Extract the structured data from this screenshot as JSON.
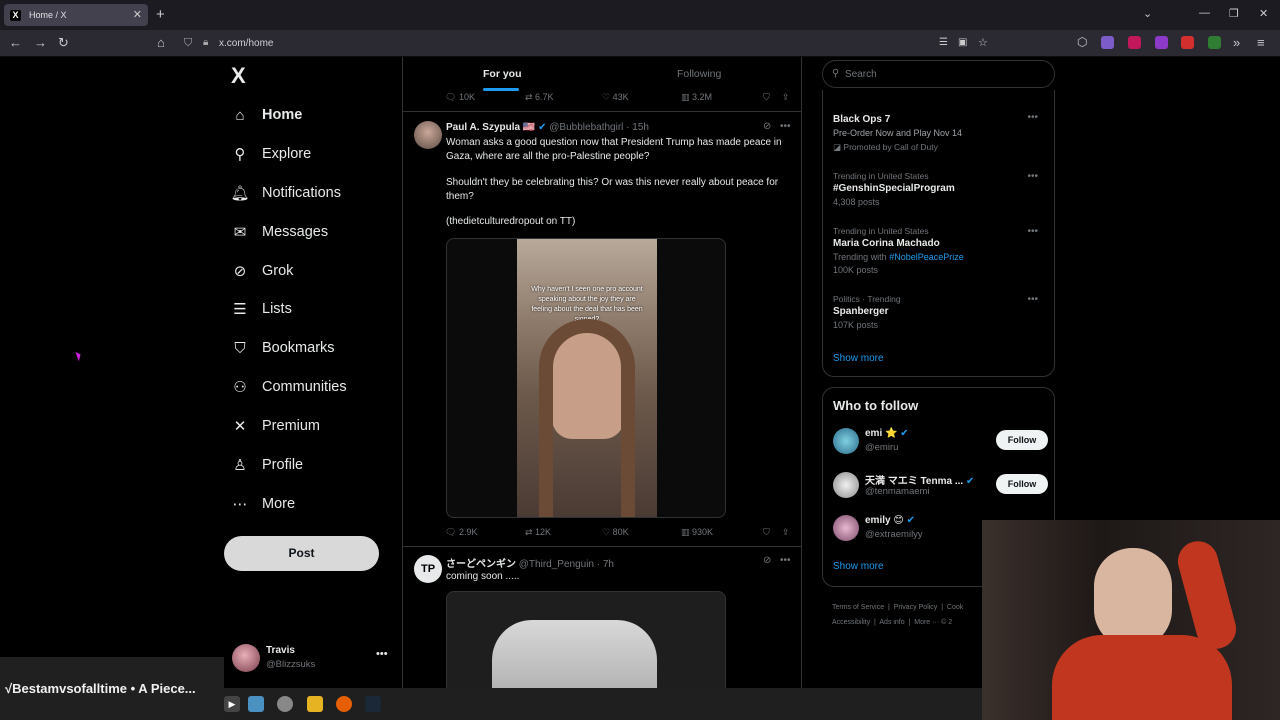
{
  "browser": {
    "tab_title": "Home / X",
    "url": "x.com/home"
  },
  "nav": {
    "logo": "X",
    "items": [
      {
        "label": "Home",
        "icon": "home-icon"
      },
      {
        "label": "Explore",
        "icon": "search-icon"
      },
      {
        "label": "Notifications",
        "icon": "bell-icon"
      },
      {
        "label": "Messages",
        "icon": "mail-icon"
      },
      {
        "label": "Grok",
        "icon": "grok-icon"
      },
      {
        "label": "Lists",
        "icon": "list-icon"
      },
      {
        "label": "Bookmarks",
        "icon": "bookmark-icon"
      },
      {
        "label": "Communities",
        "icon": "people-icon"
      },
      {
        "label": "Premium",
        "icon": "x-icon"
      },
      {
        "label": "Profile",
        "icon": "person-icon"
      },
      {
        "label": "More",
        "icon": "more-circle-icon"
      }
    ],
    "post_label": "Post"
  },
  "account": {
    "name": "Travis",
    "handle": "@Blizzsuks"
  },
  "feed": {
    "tabs": [
      "For you",
      "Following"
    ],
    "prev_actions": {
      "replies": "10K",
      "reposts": "6.7K",
      "likes": "43K",
      "views": "3.2M"
    },
    "tweet1": {
      "name": "Paul A. Szypula 🇺🇸",
      "handle": "@Bubblebathgirl",
      "time": "· 15h",
      "text1": "Woman asks a good question now that President Trump has made peace in Gaza, where are all the pro-Palestine people?",
      "text2": "Shouldn't they be celebrating this? Or was this never really about peace for them?",
      "text3": "(thedietculturedropout on TT)",
      "video_caption": "Why haven't I seen one pro account speaking about the joy they are feeling about the deal that has been signed?",
      "actions": {
        "replies": "2.9K",
        "reposts": "12K",
        "likes": "80K",
        "views": "930K"
      }
    },
    "tweet2": {
      "avatar_text": "TP",
      "name": "さーどペンギン",
      "handle": "@Third_Penguin",
      "time": "· 7h",
      "text": "coming soon ....."
    }
  },
  "sidebar": {
    "search_placeholder": "Search",
    "trends": [
      {
        "meta": "",
        "title": "Black Ops 7",
        "sub": "Pre-Order Now and Play Nov 14",
        "extra": "Promoted by Call of Duty"
      },
      {
        "meta": "Trending in United States",
        "title": "#GenshinSpecialProgram",
        "sub": "4,308 posts"
      },
      {
        "meta": "Trending in United States",
        "title": "Maria Corina Machado",
        "sub_prefix": "Trending with",
        "sub_link": "#NobelPeacePrize",
        "sub": "100K posts"
      },
      {
        "meta": "Politics · Trending",
        "title": "Spanberger",
        "sub": "107K posts"
      }
    ],
    "show_more": "Show more",
    "who_to_follow": {
      "title": "Who to follow",
      "users": [
        {
          "name": "emi ⭐",
          "handle": "@emiru",
          "button": "Follow"
        },
        {
          "name": "天満 マエミ Tenma ...",
          "handle": "@tenmamaemi",
          "button": "Follow"
        },
        {
          "name": "emily 😊",
          "handle": "@extraemilyy",
          "button": ""
        }
      ],
      "show_more": "Show more"
    },
    "footer": [
      "Terms of Service",
      "Privacy Policy",
      "Cook",
      "Accessibility",
      "Ads info",
      "More ···",
      "© 2"
    ]
  },
  "now_playing": "√Bestamvsofalltime • A Piece...",
  "colors": {
    "accent": "#1d9bf0",
    "background": "#000000",
    "border": "#2f3336"
  }
}
